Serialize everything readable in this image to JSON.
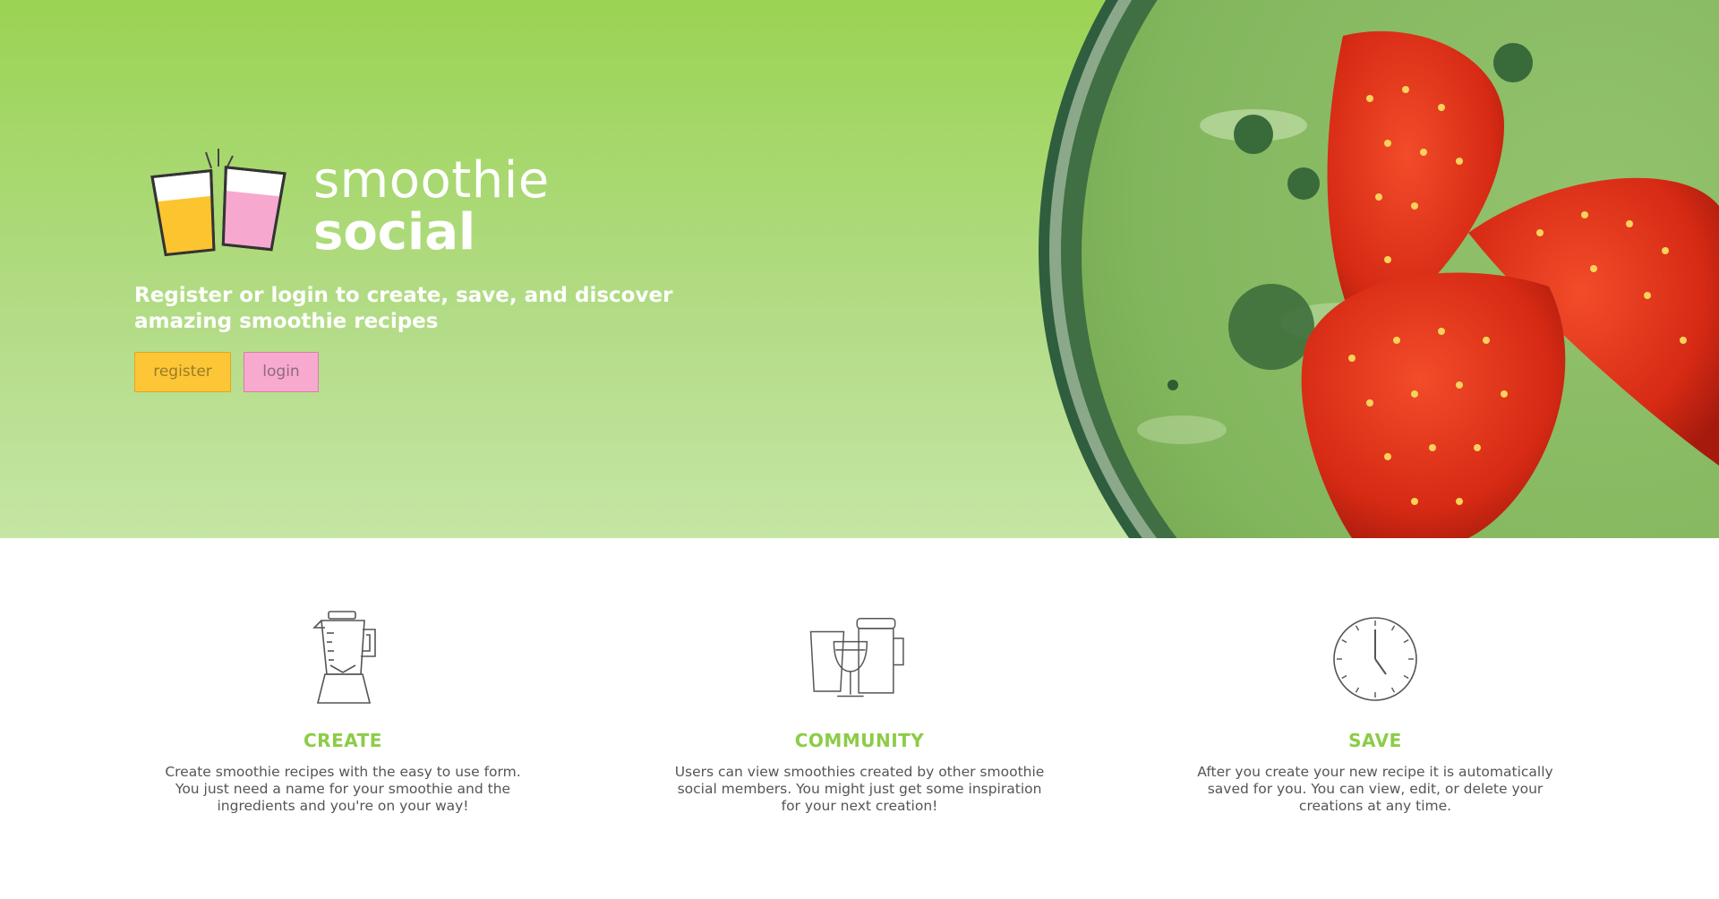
{
  "brand": {
    "line1": "smoothie",
    "line2": "social"
  },
  "hero": {
    "tagline": "Register or login to create, save, and discover amazing smoothie recipes",
    "register_label": "register",
    "login_label": "login"
  },
  "features": [
    {
      "icon": "blender-icon",
      "title": "CREATE",
      "description": "Create smoothie recipes with the easy to use form. You just need a name for your smoothie and the ingredients and you're on your way!"
    },
    {
      "icon": "glasses-icon",
      "title": "COMMUNITY",
      "description": "Users can view smoothies created by other smoothie social members. You might just get some inspiration for your next creation!"
    },
    {
      "icon": "clock-icon",
      "title": "SAVE",
      "description": "After you create your new recipe it is automatically saved for you. You can view, edit, or delete your creations at any time."
    }
  ],
  "colors": {
    "hero_green": "#9bd354",
    "accent_green": "#8ccc47",
    "register_yellow": "#fdc636",
    "login_pink": "#f7a9ce"
  }
}
